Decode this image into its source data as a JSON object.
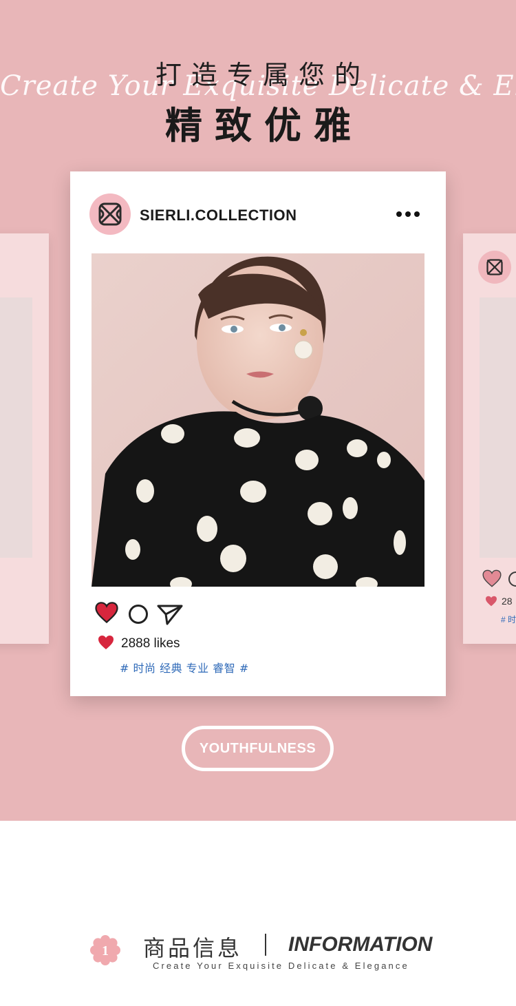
{
  "header": {
    "title_line1": "打造专属您的",
    "script_line": "Create Your Exquisite Delicate & Elegance",
    "title_line2": "精致优雅"
  },
  "post": {
    "account_name": "SIERLI.COLLECTION",
    "menu_icon": "more-dots-icon",
    "likes": "2888 likes",
    "hashtags": "# 时尚 经典 专业 睿智 #",
    "icons": [
      "heart-icon",
      "comment-icon",
      "share-icon"
    ]
  },
  "side_card_right": {
    "likes_partial": "28",
    "tag_partial": "# 时"
  },
  "badge": {
    "label": "YOUTHFULNESS"
  },
  "info_section": {
    "number": "1",
    "title_cn": "商品信息",
    "separator": "|",
    "title_en": "INFORMATION",
    "subtitle": "Create Your Exquisite Delicate & Elegance"
  },
  "colors": {
    "background_pink": "#e8b6b8",
    "card_white": "#ffffff",
    "heart_red": "#d7263d",
    "tag_blue": "#2f6ab8",
    "text_dark": "#333333"
  }
}
